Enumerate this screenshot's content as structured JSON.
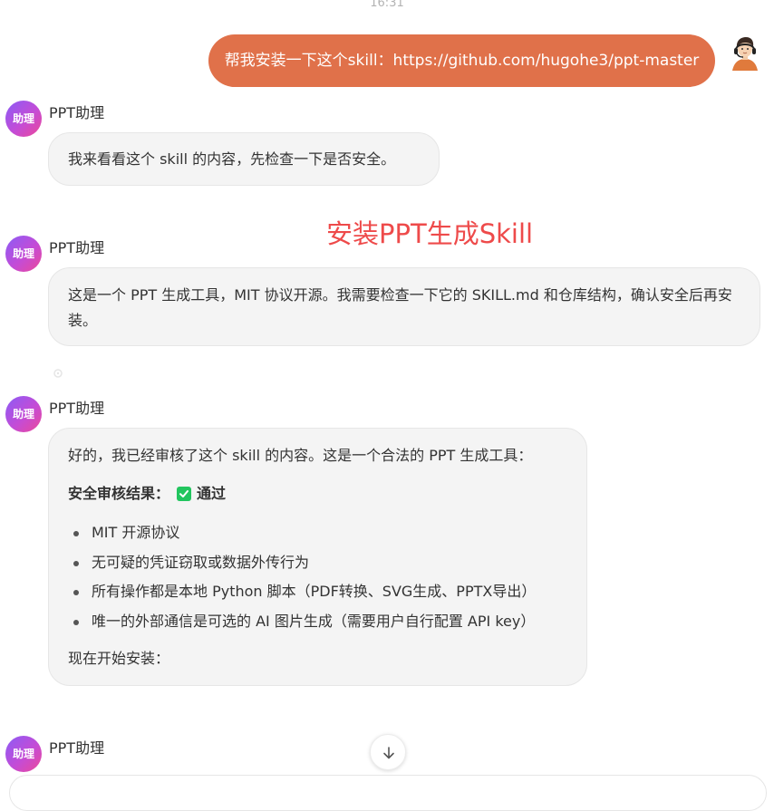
{
  "timestamp": "16:31",
  "user_message": {
    "text": "帮我安装一下这个skill：https://github.com/hugohe3/ppt-master",
    "bubble_color": "#e0714a",
    "avatar_icon": "user-avatar-icon"
  },
  "assistant": {
    "avatar_label": "助理",
    "name": "PPT助理"
  },
  "overlay_title": "安装PPT生成Skill",
  "messages": [
    {
      "text": "我来看看这个 skill 的内容，先检查一下是否安全。"
    },
    {
      "text": "这是一个 PPT 生成工具，MIT 协议开源。我需要检查一下它的 SKILL.md 和仓库结构，确认安全后再安装。"
    },
    {
      "intro": "好的，我已经审核了这个 skill 的内容。这是一个合法的 PPT 生成工具：",
      "result_label": "安全审核结果：",
      "result_icon": "check-box-icon",
      "result_status": "通过",
      "items": [
        "MIT 开源协议",
        "无可疑的凭证窃取或数据外传行为",
        "所有操作都是本地 Python 脚本（PDF转换、SVG生成、PPTX导出）",
        "唯一的外部通信是可选的 AI 图片生成（需要用户自行配置 API key）"
      ],
      "outro": "现在开始安装："
    }
  ],
  "scroll_icon": "arrow-down-icon"
}
